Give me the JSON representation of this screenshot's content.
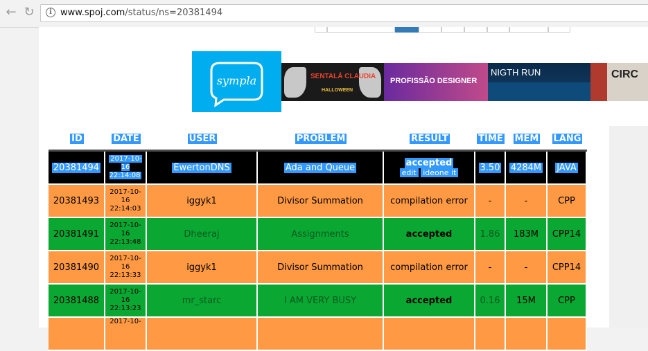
{
  "browser": {
    "url_host": "www.spoj.com",
    "url_path": "/status/ns=20381494"
  },
  "ads": {
    "logo_text": "sympla",
    "tiles": [
      {
        "name": "sentala-claudia",
        "title": "SENTALÁ CLAUDIA",
        "subtitle": "HALLOWEEN"
      },
      {
        "name": "profissao-designer",
        "title": "PROFISSÃO DESIGNER"
      },
      {
        "name": "nigth-run",
        "title": "NIGTH RUN"
      },
      {
        "name": "circo",
        "title": "CIRC"
      }
    ]
  },
  "table": {
    "headers": [
      "ID",
      "DATE",
      "USER",
      "PROBLEM",
      "RESULT",
      "TIME",
      "MEM",
      "LANG"
    ],
    "rows": [
      {
        "style": "black",
        "id": "20381494",
        "date": "2017-10-\n16\n22:14:08",
        "user": "EwertonDNS",
        "problem": "Ada and Queue",
        "result": "accepted",
        "links": [
          "edit",
          "ideone it"
        ],
        "time": "3.50",
        "mem": "4284M",
        "lang": "JAVA"
      },
      {
        "style": "orange",
        "id": "20381493",
        "date": "2017-10-\n16\n22:14:03",
        "user": "iggyk1",
        "problem": "Divisor Summation",
        "result": "compilation error",
        "time": "-",
        "mem": "-",
        "lang": "CPP"
      },
      {
        "style": "green",
        "id": "20381491",
        "date": "2017-10-\n16\n22:13:48",
        "user": "Dheeraj",
        "problem": "Assignments",
        "result": "accepted",
        "time": "1.86",
        "mem": "183M",
        "lang": "CPP14"
      },
      {
        "style": "orange",
        "id": "20381490",
        "date": "2017-10-\n16\n22:13:33",
        "user": "iggyk1",
        "problem": "Divisor Summation",
        "result": "compilation error",
        "time": "-",
        "mem": "-",
        "lang": "CPP14"
      },
      {
        "style": "green",
        "id": "20381488",
        "date": "2017-10-\n16\n22:13:23",
        "user": "mr_starc",
        "problem": "I AM VERY BUSY",
        "result": "accepted",
        "time": "0.16",
        "mem": "15M",
        "lang": "CPP"
      },
      {
        "style": "orange",
        "id": "",
        "date": "2017-10-",
        "user": "",
        "problem": "",
        "result": "",
        "time": "",
        "mem": "",
        "lang": ""
      }
    ]
  },
  "colors": {
    "accepted": "#0aa832",
    "compilation_error": "#ff9944",
    "selected_row": "#000000",
    "selection_highlight": "#3399ff"
  }
}
